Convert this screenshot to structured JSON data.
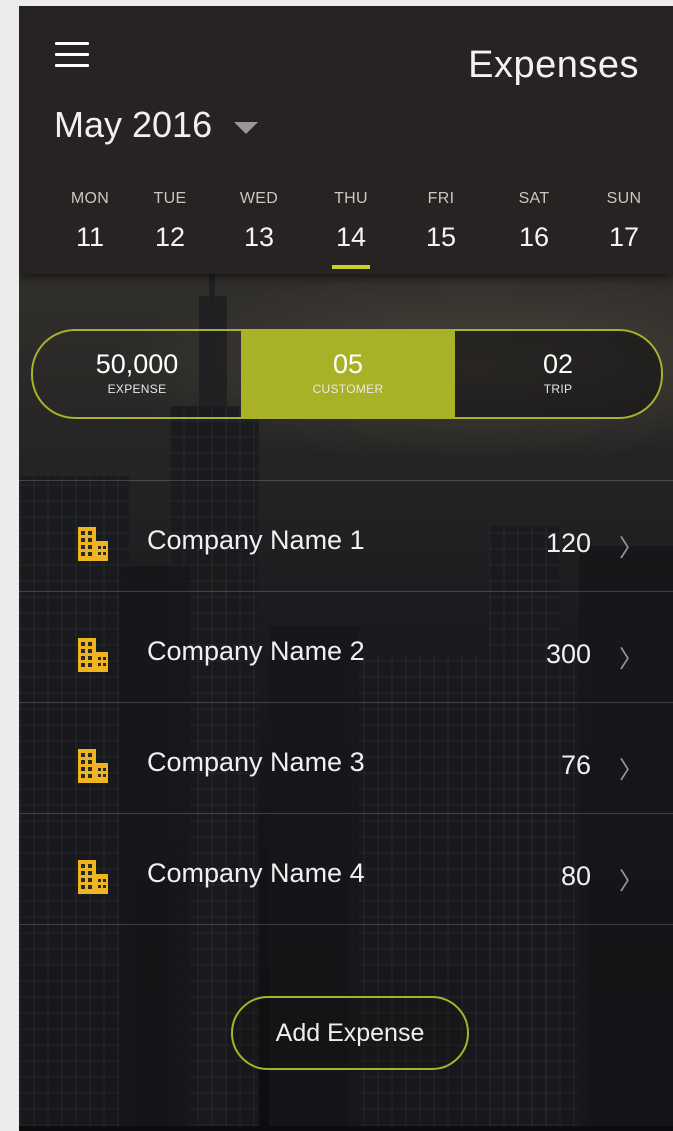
{
  "header": {
    "title": "Expenses",
    "month": "May 2016"
  },
  "week": {
    "days": [
      {
        "name": "MON",
        "date": "11"
      },
      {
        "name": "TUE",
        "date": "12"
      },
      {
        "name": "WED",
        "date": "13"
      },
      {
        "name": "THU",
        "date": "14"
      },
      {
        "name": "FRI",
        "date": "15"
      },
      {
        "name": "SAT",
        "date": "16"
      },
      {
        "name": "SUN",
        "date": "17"
      }
    ],
    "selected_index": 3
  },
  "stats": [
    {
      "value": "50,000",
      "label": "EXPENSE"
    },
    {
      "value": "05",
      "label": "CUSTOMER"
    },
    {
      "value": "02",
      "label": "TRIP"
    }
  ],
  "companies": [
    {
      "name": "Company Name 1",
      "amount": "120"
    },
    {
      "name": "Company Name 2",
      "amount": "300"
    },
    {
      "name": "Company Name 3",
      "amount": "76"
    },
    {
      "name": "Company Name 4",
      "amount": "80"
    }
  ],
  "actions": {
    "add_expense_label": "Add Expense"
  },
  "colors": {
    "accent": "#a9b226",
    "underline": "#c7d227",
    "building_icon": "#f0b51e",
    "header_bg": "#262322"
  },
  "icons": {
    "menu": "hamburger-menu-icon",
    "month_dropdown": "caret-down-icon",
    "company": "office-building-icon",
    "row_arrow": "chevron-right-icon"
  }
}
